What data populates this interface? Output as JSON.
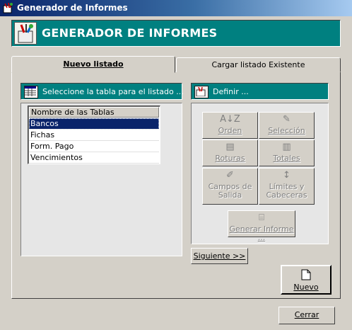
{
  "window": {
    "title": "Generador de Informes"
  },
  "banner": {
    "title": "GENERADOR DE INFORMES"
  },
  "tabs": {
    "active": "Nuevo listado",
    "inactive": "Cargar listado Existente"
  },
  "left_panel": {
    "header": "Seleccione la tabla para el listado ...",
    "list_header": "Nombre de las Tablas",
    "items": [
      "Bancos",
      "Fichas",
      "Form. Pago",
      "Vencimientos"
    ],
    "selected": "Bancos"
  },
  "right_panel": {
    "header": "Definir ...",
    "buttons": {
      "orden": "Orden",
      "seleccion": "Selección",
      "roturas": "Roturas",
      "totales": "Totales",
      "campos_1": "Campos de",
      "campos_2": "Salida",
      "limites_1": "Límites y",
      "limites_2": "Cabeceras",
      "generar": "Generar Informe ..."
    }
  },
  "actions": {
    "siguiente": "Siguiente >>",
    "nuevo": "Nuevo",
    "cerrar": "Cerrar"
  }
}
